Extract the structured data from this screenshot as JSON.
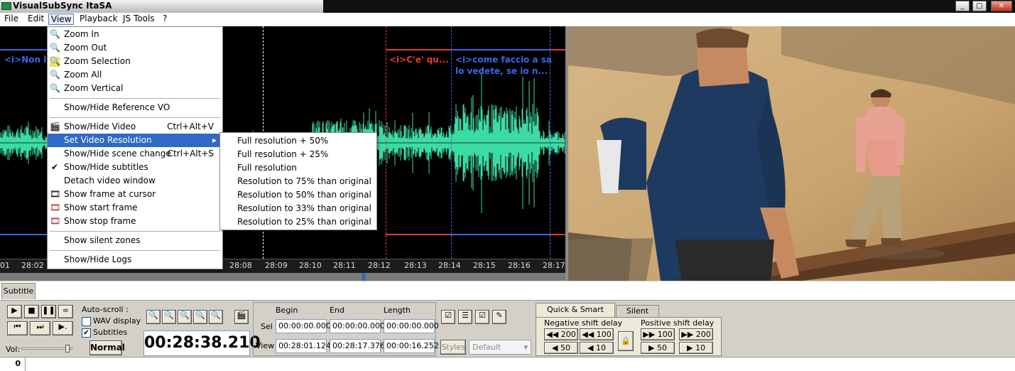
{
  "window": {
    "title": "VisualSubSync ItaSA"
  },
  "menubar": [
    {
      "label": "File"
    },
    {
      "label": "Edit"
    },
    {
      "label": "View"
    },
    {
      "label": "Playback"
    },
    {
      "label": "JS Tools"
    },
    {
      "label": "?"
    }
  ],
  "view_menu": {
    "items": [
      {
        "label": "Zoom In",
        "icon": "zoom-in-icon"
      },
      {
        "label": "Zoom Out",
        "icon": "zoom-out-icon"
      },
      {
        "label": "Zoom Selection",
        "icon": "zoom-selection-icon"
      },
      {
        "label": "Zoom All",
        "icon": "zoom-all-icon"
      },
      {
        "label": "Zoom Vertical",
        "icon": "zoom-vertical-icon"
      },
      {
        "label": "Show/Hide Reference VO"
      },
      {
        "label": "Show/Hide Video",
        "shortcut": "Ctrl+Alt+V",
        "icon": "video-icon"
      },
      {
        "label": "Set Video Resolution"
      },
      {
        "label": "Show/Hide scene change",
        "shortcut": "Ctrl+Alt+S"
      },
      {
        "label": "Show/Hide subtitles",
        "checked": "✔"
      },
      {
        "label": "Detach video window"
      },
      {
        "label": "Show frame at cursor",
        "icon": "frame-cursor-icon"
      },
      {
        "label": "Show start frame",
        "icon": "start-frame-icon"
      },
      {
        "label": "Show stop frame",
        "icon": "stop-frame-icon"
      },
      {
        "label": "Show silent zones"
      },
      {
        "label": "Show/Hide Logs"
      }
    ]
  },
  "resolution_submenu": [
    "Full resolution + 50%",
    "Full resolution + 25%",
    "Full resolution",
    "Resolution to 75% than original",
    "Resolution to 50% than original",
    "Resolution to 33% than original",
    "Resolution to 25% than original"
  ],
  "waveform": {
    "subtitles": [
      {
        "text": "<i>Non lo"
      },
      {
        "text": "<i>C'e' qu..."
      },
      {
        "line1": "<i>come faccio a sa",
        "line2": "lo vedete, se io n..."
      }
    ],
    "ticks": [
      "01",
      "28:02",
      "28:08",
      "28:09",
      "28:10",
      "28:11",
      "28:12",
      "28:13",
      "28:14",
      "28:15",
      "28:16",
      "28:17"
    ]
  },
  "panel": {
    "tab": "Subtitle",
    "autoscroll_label": "Auto-scroll :",
    "wav_display_label": "WAV display",
    "subtitles_label": "Subtitles",
    "subtitles_checked": "✔",
    "vol_label": "Vol:",
    "normal_label": "Normal",
    "time": "00:28:38.210",
    "table": {
      "headers": {
        "begin": "Begin",
        "end": "End",
        "length": "Length"
      },
      "sel": {
        "label": "Sel",
        "begin": "00:00:00.000",
        "end": "00:00:00.000",
        "length": "00:00:00.000"
      },
      "view": {
        "label": "View",
        "begin": "00:28:01.124",
        "end": "00:28:17.376",
        "length": "00:00:16.252"
      }
    },
    "styles_label": "Styles",
    "style_value": "Default",
    "delay_tabs": {
      "quick": "Quick & Smart Delay",
      "silent": "Silent Zone"
    },
    "negative_label": "Negative shift delay",
    "positive_label": "Positive shift delay",
    "neg_buttons": [
      "200",
      "100",
      "50",
      "10"
    ],
    "pos_buttons": [
      "100",
      "200",
      "50",
      "10"
    ]
  },
  "status": {
    "value": "0"
  },
  "colors": {
    "wave": "#3ddba4",
    "sub_blue": "#3b66e8",
    "sub_red": "#e63a3a",
    "menu_highlight": "#3169c6"
  }
}
